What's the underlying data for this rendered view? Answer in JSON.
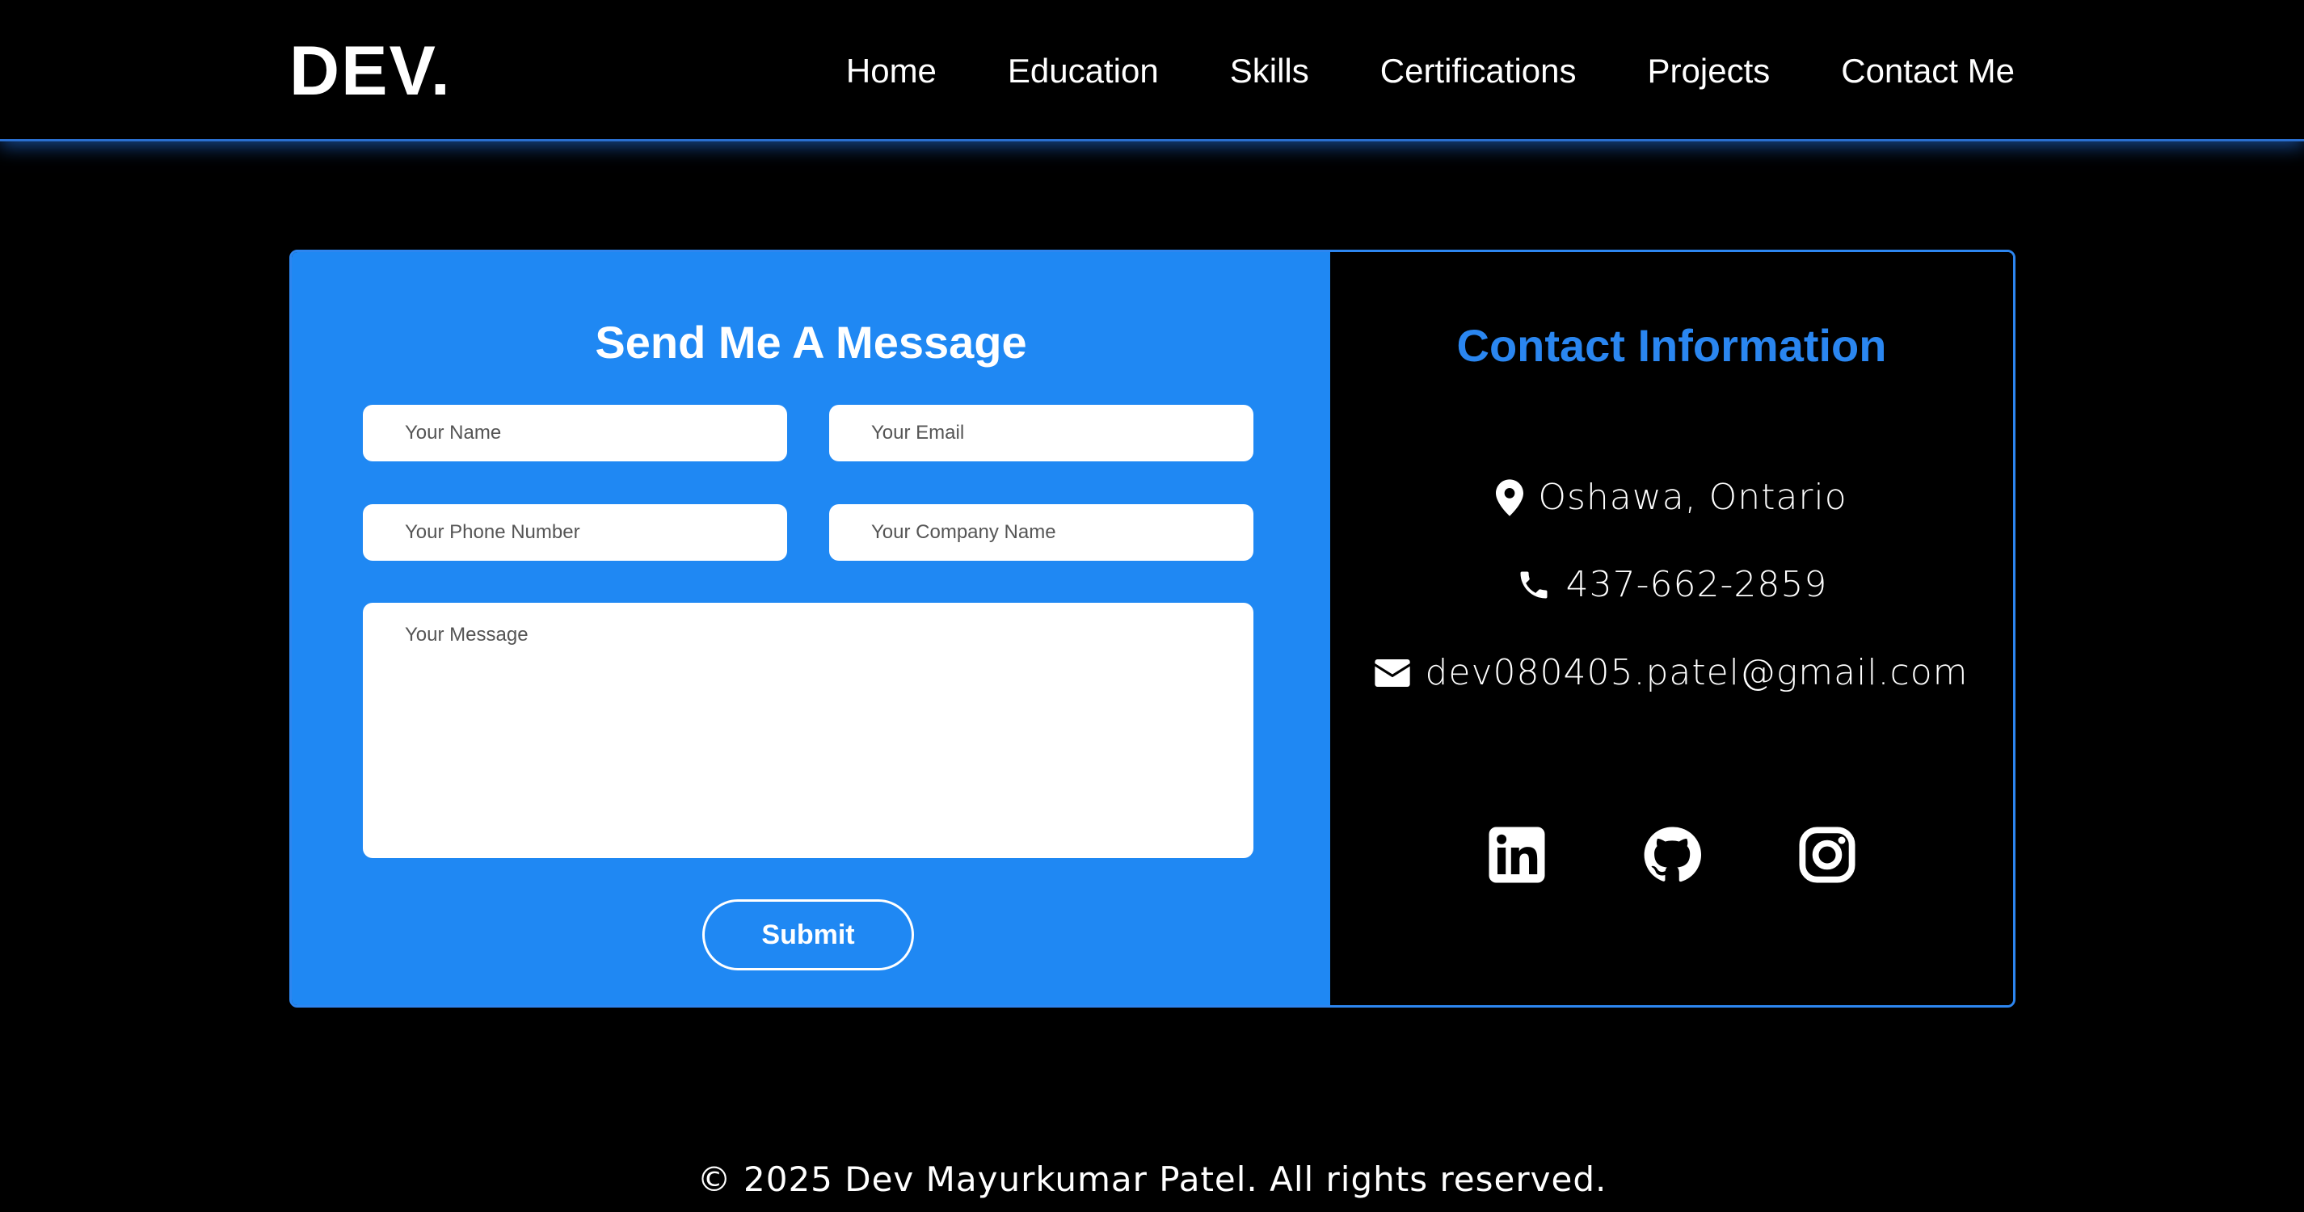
{
  "header": {
    "logo": "DEV.",
    "nav": [
      "Home",
      "Education",
      "Skills",
      "Certifications",
      "Projects",
      "Contact Me"
    ]
  },
  "form": {
    "title": "Send Me A Message",
    "name_placeholder": "Your Name",
    "email_placeholder": "Your Email",
    "phone_placeholder": "Your Phone Number",
    "company_placeholder": "Your Company Name",
    "message_placeholder": "Your Message",
    "submit_label": "Submit"
  },
  "contact": {
    "title": "Contact Information",
    "location": "Oshawa, Ontario",
    "phone": "437-662-2859",
    "email": "dev080405.patel@gmail.com",
    "social": [
      "linkedin-icon",
      "github-icon",
      "instagram-icon"
    ]
  },
  "footer": {
    "text": "© 2025 Dev Mayurkumar Patel. All rights reserved."
  },
  "colors": {
    "accent": "#1f88f3",
    "background": "#000000",
    "text": "#ffffff"
  }
}
